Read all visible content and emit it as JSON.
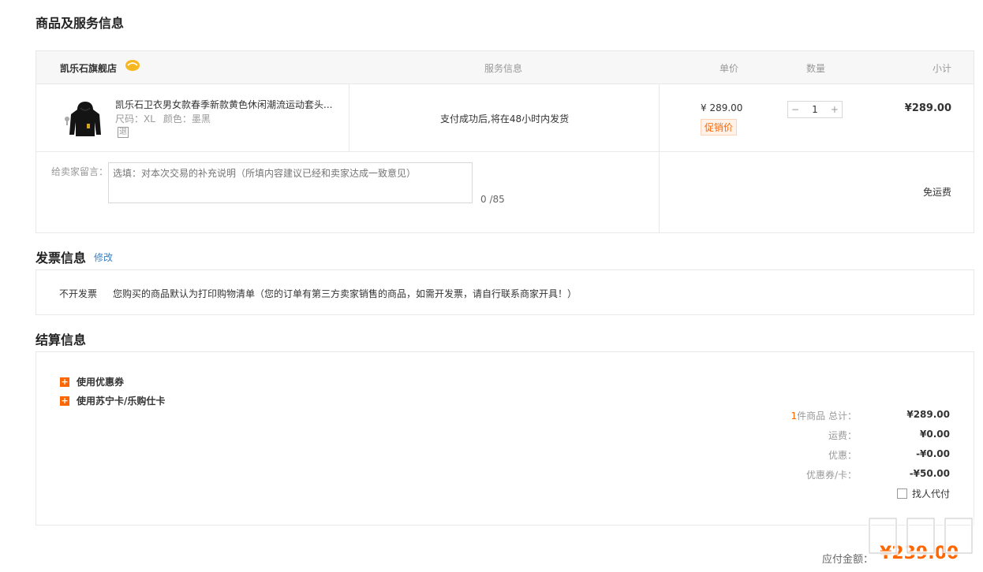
{
  "titles": {
    "goods": "商品及服务信息",
    "invoice": "发票信息",
    "settle": "结算信息"
  },
  "goods_header": {
    "store_name": "凯乐石旗舰店",
    "service": "服务信息",
    "unit_price": "单价",
    "quantity": "数量",
    "subtotal": "小计"
  },
  "product": {
    "title": "凯乐石卫衣男女款春季新款黄色休闲潮流运动套头...",
    "size_label": "尺码：XL",
    "color_label": "颜色：墨黑",
    "return_tag": "退",
    "service_text": "支付成功后,将在48小时内发货",
    "unit_price": "¥ 289.00",
    "promo_tag": "促销价",
    "qty_minus": "−",
    "qty_value": "1",
    "qty_plus": "+",
    "subtotal": "¥289.00"
  },
  "message": {
    "label": "给卖家留言：",
    "placeholder": "选填：对本次交易的补充说明（所填内容建议已经和卖家达成一致意见）",
    "count": "0 /85",
    "shipping": "免运费"
  },
  "invoice": {
    "edit": "修改",
    "type": "不开发票",
    "desc": "您购买的商品默认为打印购物清单（您的订单有第三方卖家销售的商品，如需开发票，请自行联系商家开具！）"
  },
  "settle": {
    "use_coupon": "使用优惠券",
    "use_card": "使用苏宁卡/乐购仕卡",
    "items_count": "1",
    "items_label": "件商品 总计：",
    "items_total": "¥289.00",
    "freight_label": "运费：",
    "freight_val": "¥0.00",
    "discount_label": "优惠：",
    "discount_val": "-¥0.00",
    "coupon_label": "优惠券/卡：",
    "coupon_val": "-¥50.00",
    "proxy_pay": "找人代付"
  },
  "payable": {
    "label": "应付金额：",
    "amount": "¥239.00"
  },
  "colors": {
    "accent": "#ff6600",
    "link": "#3a80c4",
    "border": "#e8e8e8"
  }
}
